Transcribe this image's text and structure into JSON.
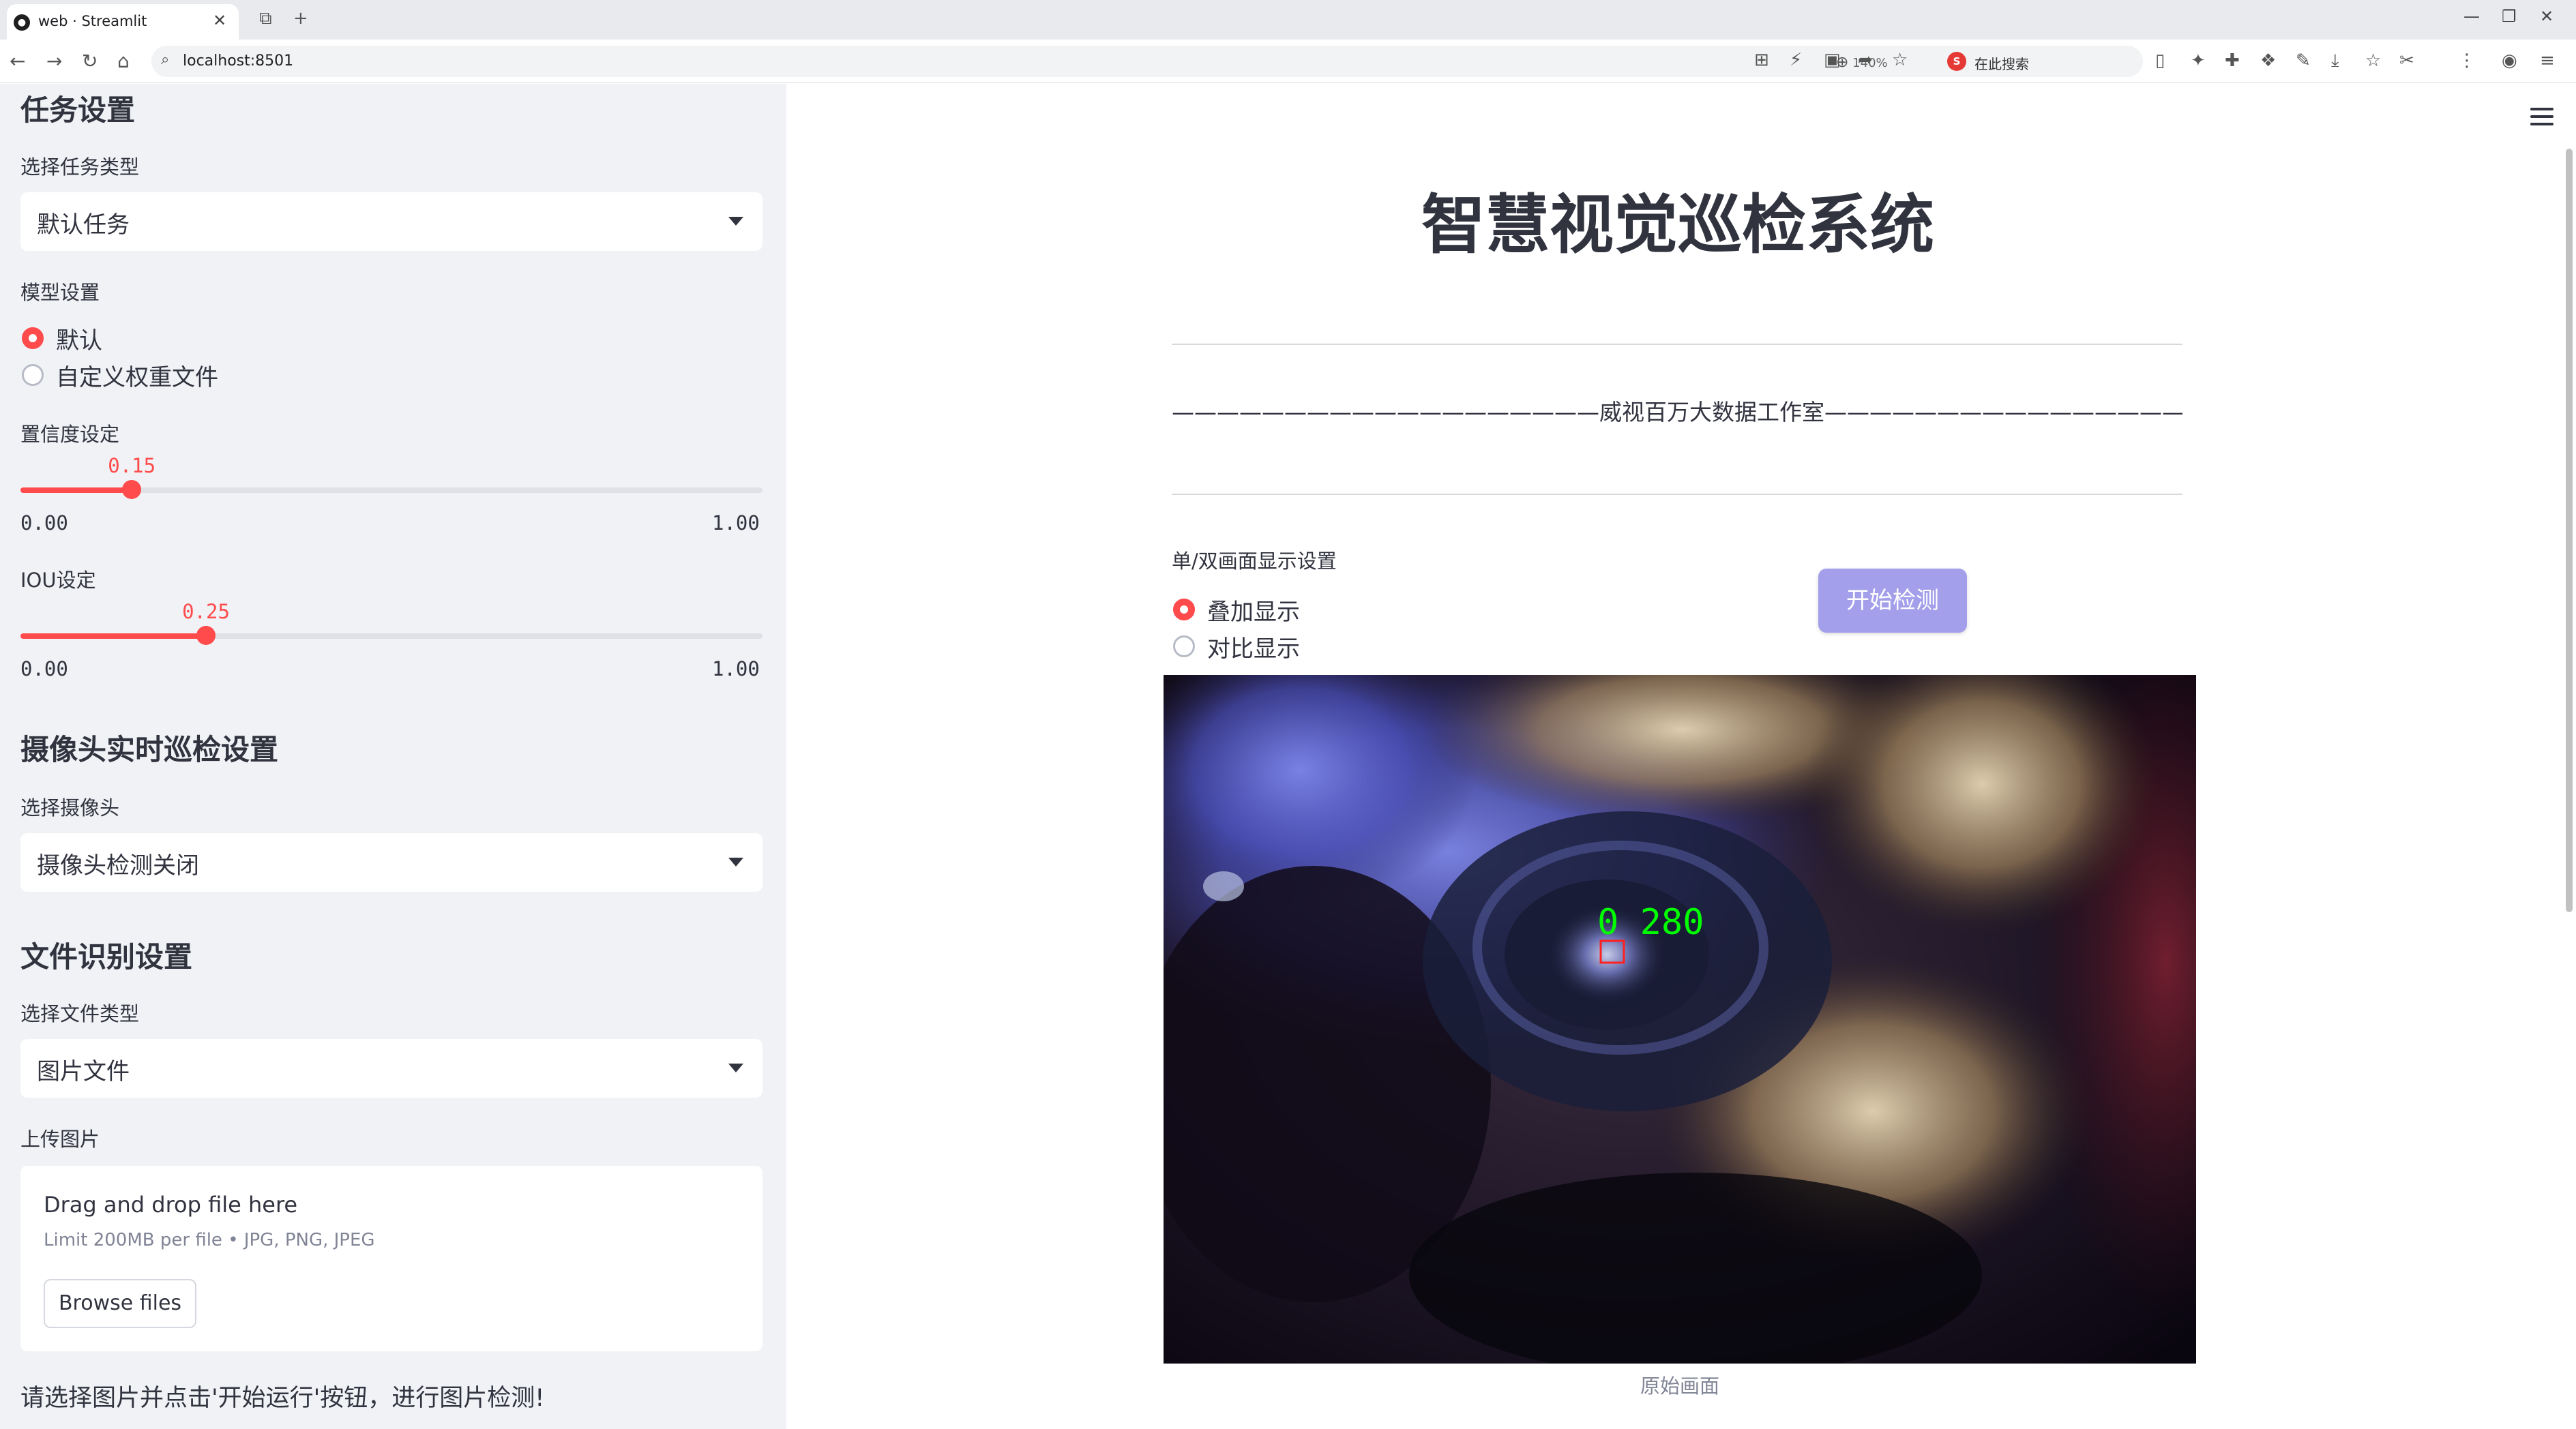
{
  "browser": {
    "tab_title": "web · Streamlit",
    "url": "localhost:8501",
    "zoom": "140%",
    "search_label": "在此搜索",
    "search_logo": "S"
  },
  "sidebar": {
    "task_header": "任务设置",
    "task_type_label": "选择任务类型",
    "task_type_value": "默认任务",
    "model_label": "模型设置",
    "model_options": [
      "默认",
      "自定义权重文件"
    ],
    "model_selected": 0,
    "conf_label": "置信度设定",
    "conf": {
      "value": 0.15,
      "value_text": "0.15",
      "min_text": "0.00",
      "max_text": "1.00"
    },
    "iou_label": "IOU设定",
    "iou": {
      "value": 0.25,
      "value_text": "0.25",
      "min_text": "0.00",
      "max_text": "1.00"
    },
    "camera_header": "摄像头实时巡检设置",
    "camera_label": "选择摄像头",
    "camera_value": "摄像头检测关闭",
    "file_header": "文件识别设置",
    "file_type_label": "选择文件类型",
    "file_type_value": "图片文件",
    "upload_label": "上传图片",
    "upload_main": "Drag and drop file here",
    "upload_sub": "Limit 200MB per file • JPG, PNG, JPEG",
    "browse_label": "Browse files",
    "note": "请选择图片并点击'开始运行'按钮，进行图片检测!"
  },
  "main": {
    "title": "智慧视觉巡检系统",
    "studio_line": "———————————————————威视百万大数据工作室————————————————————",
    "display_label": "单/双画面显示设置",
    "display_options": [
      "叠加显示",
      "对比显示"
    ],
    "display_selected": 0,
    "start_button": "开始检测",
    "detection_label": "0 280",
    "caption": "原始画面"
  },
  "colors": {
    "accent": "#ff4b4b",
    "button": "#a39fea",
    "sidebar_bg": "#f0f2f6",
    "detection_text": "#00ff00",
    "detection_box": "#ff2020"
  }
}
